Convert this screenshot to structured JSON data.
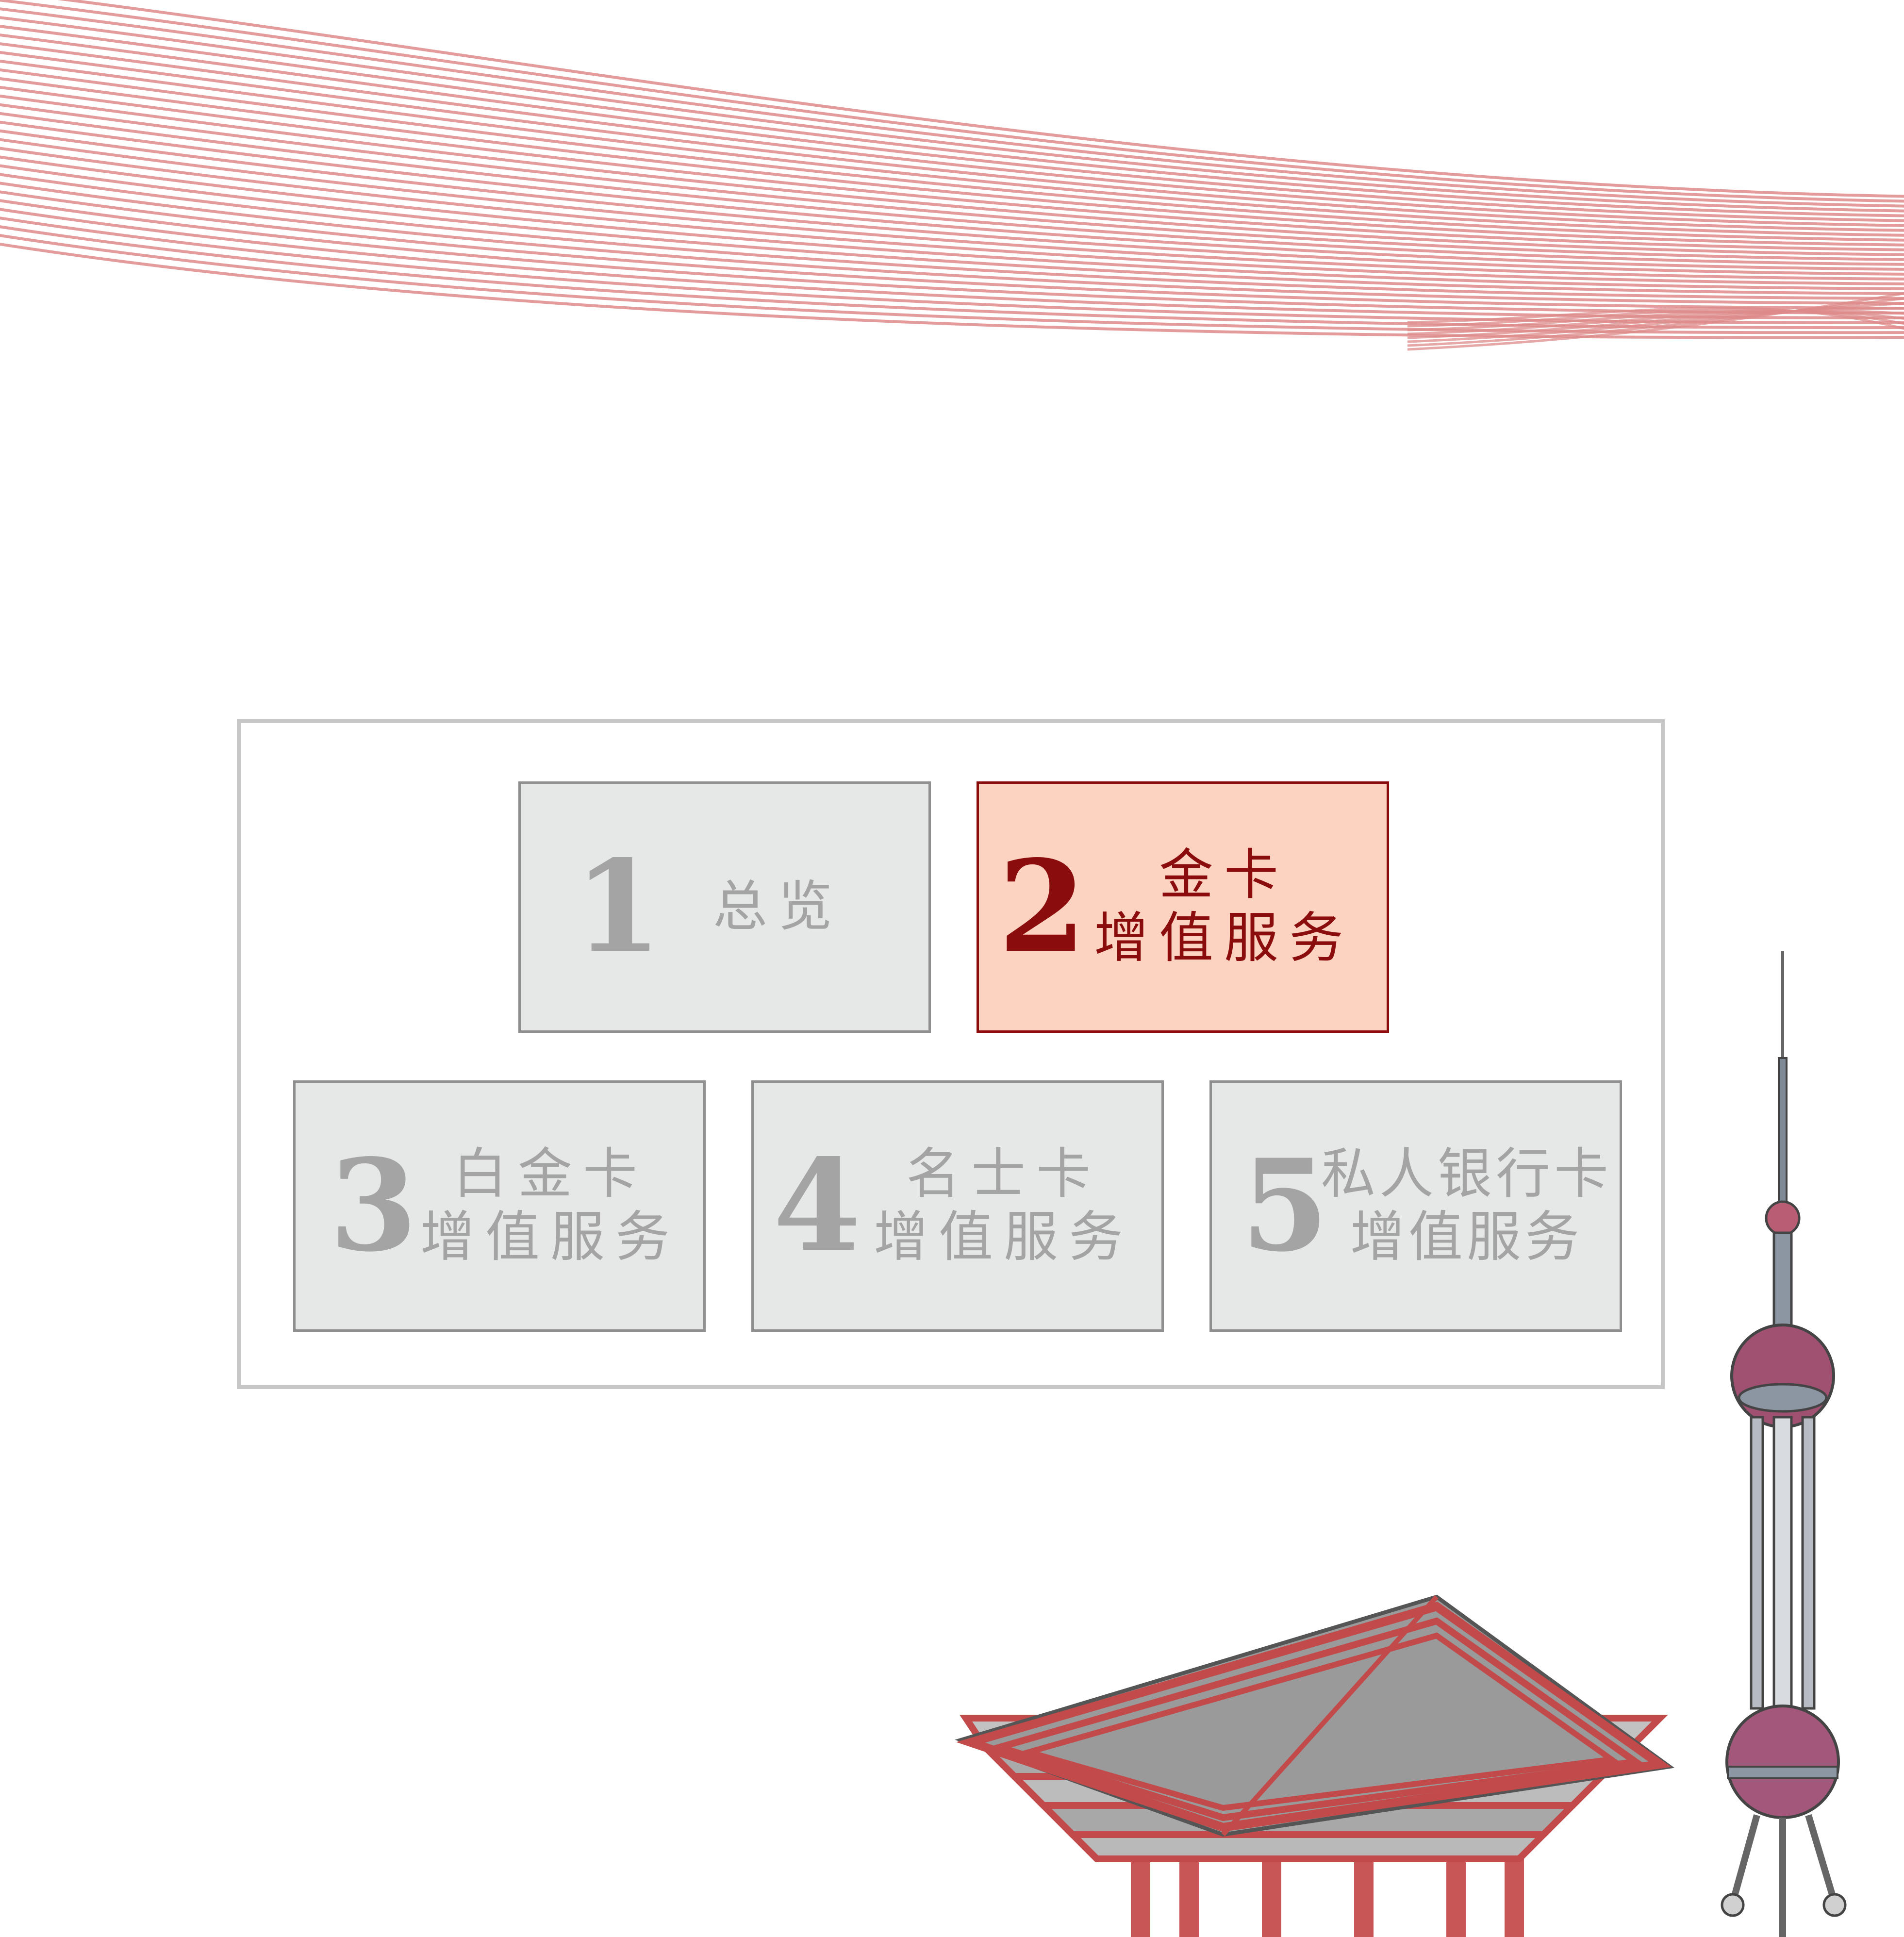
{
  "colors": {
    "active_fill": "#fcd2c0",
    "active_accent": "#8b0c0c",
    "inactive_fill": "#e6e7e7",
    "inactive_text": "#a4a4a4",
    "wave_lines": "#de8a8a"
  },
  "menu": {
    "active_index": 2,
    "items": [
      {
        "number": "1",
        "line1": "总览",
        "line2": ""
      },
      {
        "number": "2",
        "line1": "金卡",
        "line2": "增值服务"
      },
      {
        "number": "3",
        "line1": "白金卡",
        "line2": "增值服务"
      },
      {
        "number": "4",
        "line1": "名士卡",
        "line2": "增值服务"
      },
      {
        "number": "5",
        "line1": "私人银行卡",
        "line2": "增值服务"
      }
    ]
  },
  "illustrations": [
    {
      "icon": "wave-lines-decoration"
    },
    {
      "icon": "china-pavilion-illustration"
    },
    {
      "icon": "oriental-pearl-tower-illustration"
    }
  ]
}
